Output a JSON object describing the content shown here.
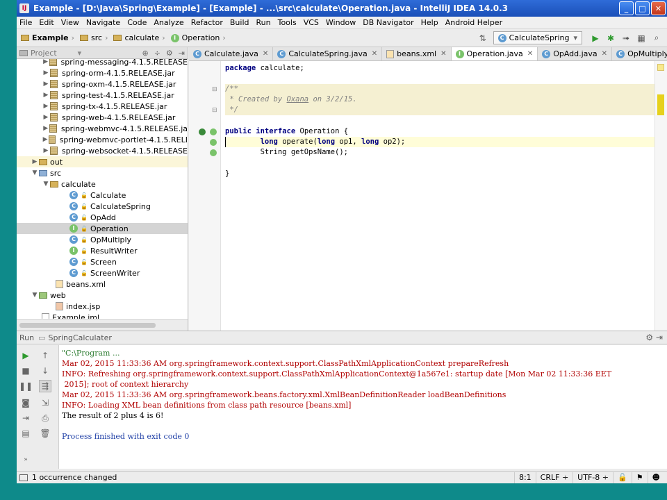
{
  "window": {
    "title": "Example - [D:\\Java\\Spring\\Example] - [Example] - ...\\src\\calculate\\Operation.java - IntelliJ IDEA 14.0.3",
    "icon": "IJ"
  },
  "menu": [
    "File",
    "Edit",
    "View",
    "Navigate",
    "Code",
    "Analyze",
    "Refactor",
    "Build",
    "Run",
    "Tools",
    "VCS",
    "Window",
    "DB Navigator",
    "Help",
    "Android Helper"
  ],
  "breadcrumbs": [
    "Example",
    "src",
    "calculate",
    "Operation"
  ],
  "run_config": "CalculateSpring",
  "project_panel": {
    "title": "Project"
  },
  "tree": [
    {
      "label": "spring-messaging-4.1.5.RELEASE",
      "icon": "jar-icon"
    },
    {
      "label": "spring-orm-4.1.5.RELEASE.jar",
      "icon": "jar-icon"
    },
    {
      "label": "spring-oxm-4.1.5.RELEASE.jar",
      "icon": "jar-icon"
    },
    {
      "label": "spring-test-4.1.5.RELEASE.jar",
      "icon": "jar-icon"
    },
    {
      "label": "spring-tx-4.1.5.RELEASE.jar",
      "icon": "jar-icon"
    },
    {
      "label": "spring-web-4.1.5.RELEASE.jar",
      "icon": "jar-icon"
    },
    {
      "label": "spring-webmvc-4.1.5.RELEASE.ja",
      "icon": "jar-icon"
    },
    {
      "label": "spring-webmvc-portlet-4.1.5.RELI",
      "icon": "jar-icon"
    },
    {
      "label": "spring-websocket-4.1.5.RELEASE",
      "icon": "jar-icon"
    },
    {
      "label": "out",
      "icon": "folder-icon"
    },
    {
      "label": "src",
      "icon": "folder-icon"
    },
    {
      "label": "calculate",
      "icon": "package-icon"
    },
    {
      "label": "Calculate",
      "icon": "class-icon"
    },
    {
      "label": "CalculateSpring",
      "icon": "class-icon"
    },
    {
      "label": "OpAdd",
      "icon": "class-icon"
    },
    {
      "label": "Operation",
      "icon": "interface-icon"
    },
    {
      "label": "OpMultiply",
      "icon": "class-icon"
    },
    {
      "label": "ResultWriter",
      "icon": "interface-icon"
    },
    {
      "label": "Screen",
      "icon": "class-icon"
    },
    {
      "label": "ScreenWriter",
      "icon": "class-icon"
    },
    {
      "label": "beans.xml",
      "icon": "xml-icon"
    },
    {
      "label": "web",
      "icon": "folder-icon"
    },
    {
      "label": "index.jsp",
      "icon": "jsp-icon"
    },
    {
      "label": "Example.iml",
      "icon": "iml-icon"
    }
  ],
  "tabs": [
    {
      "label": "Calculate.java",
      "icon": "class-icon"
    },
    {
      "label": "CalculateSpring.java",
      "icon": "class-icon"
    },
    {
      "label": "beans.xml",
      "icon": "xml-icon"
    },
    {
      "label": "Operation.java",
      "icon": "interface-icon",
      "active": true
    },
    {
      "label": "OpAdd.java",
      "icon": "class-icon"
    },
    {
      "label": "OpMultiply.java",
      "icon": "class-icon"
    }
  ],
  "code": {
    "package_kw": "package",
    "package_name": " calculate;",
    "doc_open": "/**",
    "doc_created": " * Created by ",
    "doc_author": "Oxana",
    "doc_date": " on 3/2/15.",
    "doc_close": " */",
    "public_kw": "public",
    "interface_kw": "interface",
    "iface_name": " Operation {",
    "long_kw": "long",
    "method_sig": " operate(",
    "param1": " op1, ",
    "param2": " op2);",
    "line3": "        String getOpsName();",
    "closing": "}"
  },
  "run": {
    "label": "Run",
    "config": "SpringCalculater",
    "console": [
      {
        "text": "\"C:\\Program ...",
        "color": "#2e7d32"
      },
      {
        "text": "Mar 02, 2015 11:33:36 AM org.springframework.context.support.ClassPathXmlApplicationContext prepareRefresh",
        "color": "#b00000"
      },
      {
        "text": "INFO: Refreshing org.springframework.context.support.ClassPathXmlApplicationContext@1a567e1: startup date [Mon Mar 02 11:33:36 EET",
        "color": "#b00000"
      },
      {
        "text": " 2015]; root of context hierarchy",
        "color": "#b00000"
      },
      {
        "text": "Mar 02, 2015 11:33:36 AM org.springframework.beans.factory.xml.XmlBeanDefinitionReader loadBeanDefinitions",
        "color": "#b00000"
      },
      {
        "text": "INFO: Loading XML bean definitions from class path resource [beans.xml]",
        "color": "#b00000"
      },
      {
        "text": "The result of 2 plus 4 is 6!",
        "color": "#000000"
      },
      {
        "text": "",
        "color": "#000000"
      },
      {
        "text": "Process finished with exit code 0",
        "color": "#1f3fa6"
      }
    ]
  },
  "status": {
    "message": "1 occurrence changed",
    "position": "8:1",
    "line_sep": "CRLF ÷",
    "encoding": "UTF-8 ÷"
  }
}
